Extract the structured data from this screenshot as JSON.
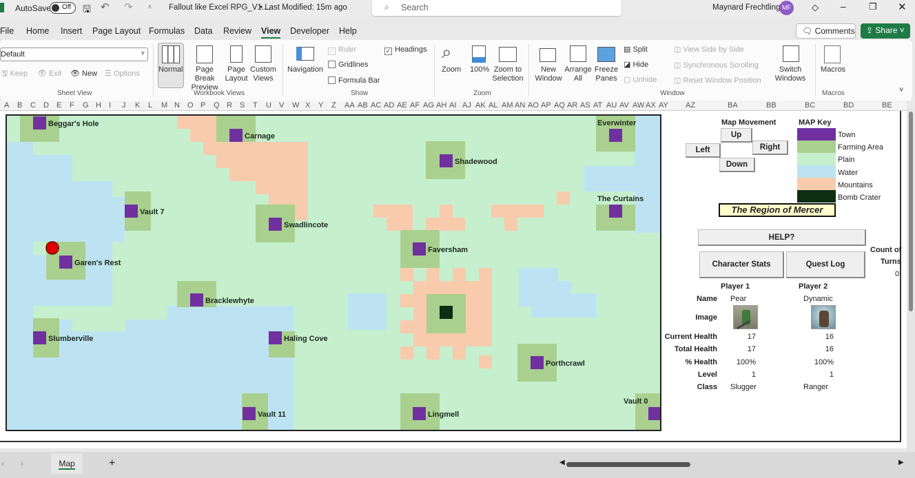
{
  "titlebar": {
    "autosave_label": "AutoSave",
    "autosave_state": "Off",
    "file_title": "Fallout like Excel RPG_V1....",
    "modified": "• Last Modified: 15m ago",
    "search_placeholder": "Search",
    "user_name": "Maynard Frechtling",
    "user_initials": "MF",
    "avatar_color": "#8e5cc8"
  },
  "menu": {
    "tabs": [
      "File",
      "Home",
      "Insert",
      "Page Layout",
      "Formulas",
      "Data",
      "Review",
      "View",
      "Developer",
      "Help"
    ],
    "active": "View",
    "comments": "Comments",
    "share": "Share",
    "share_color": "#1e7b45"
  },
  "ribbon": {
    "sheet_view": {
      "dropdown_value": "Default",
      "keep": "Keep",
      "exit": "Exit",
      "new": "New",
      "options": "Options",
      "group": "Sheet View"
    },
    "workbook_views": {
      "normal": "Normal",
      "page_break": "Page Break Preview",
      "page_layout": "Page Layout",
      "custom": "Custom Views",
      "group": "Workbook Views"
    },
    "show": {
      "navigation": "Navigation",
      "ruler": "Ruler",
      "gridlines": "Gridlines",
      "formula_bar": "Formula Bar",
      "headings": "Headings",
      "ruler_checked": true,
      "gridlines_checked": false,
      "formula_bar_checked": false,
      "headings_checked": true,
      "group": "Show"
    },
    "zoom": {
      "zoom": "Zoom",
      "hundred": "100%",
      "zoom_sel": "Zoom to Selection",
      "group": "Zoom"
    },
    "window": {
      "new_window": "New Window",
      "arrange": "Arrange All",
      "freeze": "Freeze Panes",
      "split": "Split",
      "hide": "Hide",
      "unhide": "Unhide",
      "side_by_side": "View Side by Side",
      "sync_scroll": "Synchronous Scrolling",
      "reset_pos": "Reset Window Position",
      "switch": "Switch Windows",
      "group": "Window"
    },
    "macros": {
      "macros": "Macros",
      "group": "Macros"
    }
  },
  "columns": [
    "A",
    "B",
    "C",
    "D",
    "E",
    "F",
    "G",
    "H",
    "I",
    "J",
    "K",
    "L",
    "M",
    "N",
    "O",
    "P",
    "Q",
    "R",
    "S",
    "T",
    "U",
    "V",
    "W",
    "X",
    "Y",
    "Z",
    "AA",
    "AB",
    "AC",
    "AD",
    "AE",
    "AF",
    "AG",
    "AH",
    "AI",
    "AJ",
    "AK",
    "AL",
    "AM",
    "AN",
    "AO",
    "AP",
    "AQ",
    "AR",
    "AS",
    "AT",
    "AU",
    "AV",
    "AW",
    "AX",
    "AY",
    "AZ",
    "BA",
    "BB",
    "BC",
    "BD",
    "BE"
  ],
  "map": {
    "towns": [
      "Beggar's Hole",
      "Carnage",
      "Shadewood",
      "Everwinter",
      "Vault 7",
      "Swadlincote",
      "The Curtains",
      "Garen's Rest",
      "Faversham",
      "Bracklewhyte",
      "Slumberville",
      "Haling Cove",
      "Porthcrawl",
      "Vault 11",
      "Lingmell",
      "Vault 0"
    ],
    "colors": {
      "town": "#7030a0",
      "farming": "#a9d08e",
      "plain": "#c6efce",
      "water": "#bde3f3",
      "mountains": "#f8cbad",
      "bomb": "#0e2e12",
      "player": "#e00000"
    }
  },
  "controls": {
    "movement_title": "Map Movement",
    "up": "Up",
    "left": "Left",
    "right": "Right",
    "down": "Down",
    "help": "HELP?",
    "character_stats": "Character Stats",
    "quest_log": "Quest Log",
    "count_label_1": "Count of",
    "count_label_2": "Turns",
    "count_value": "0"
  },
  "key": {
    "title": "MAP Key",
    "items": [
      "Town",
      "Farming Area",
      "Plain",
      "Water",
      "Mountains",
      "Bomb Crater"
    ],
    "region_title": "The Region of Mercer"
  },
  "players": {
    "headers": [
      "Player 1",
      "Player 2"
    ],
    "labels": [
      "Name",
      "Image",
      "Current Health",
      "Total Health",
      "% Health",
      "Level",
      "Class"
    ],
    "p1": {
      "name": "Pear",
      "current_health": "17",
      "total_health": "17",
      "pct_health": "100%",
      "level": "1",
      "class": "Slugger"
    },
    "p2": {
      "name": "Dynamic",
      "current_health": "16",
      "total_health": "16",
      "pct_health": "100%",
      "level": "1",
      "class": "Ranger"
    }
  },
  "sheets": {
    "tabs": [
      "Map"
    ],
    "active": "Map"
  }
}
